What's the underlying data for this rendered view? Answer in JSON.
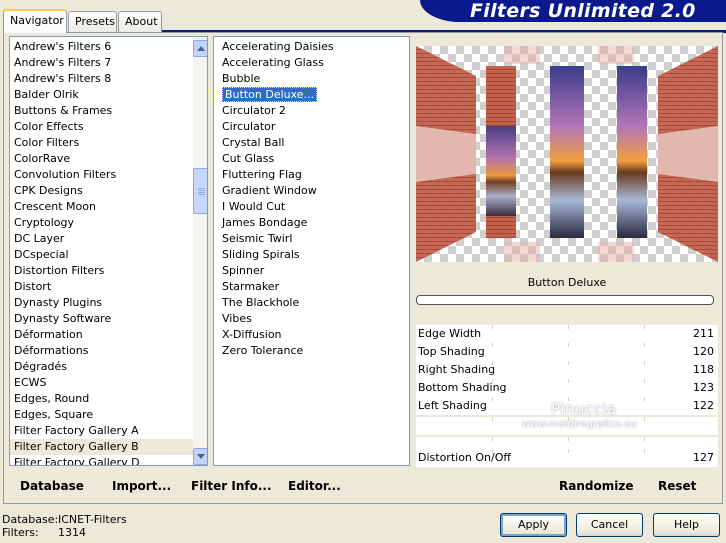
{
  "banner": {
    "title": "Filters Unlimited 2.0"
  },
  "tabs": [
    {
      "label": "Navigator",
      "active": true
    },
    {
      "label": "Presets",
      "active": false
    },
    {
      "label": "About",
      "active": false
    }
  ],
  "categories": {
    "items": [
      "Andrew's Filters 6",
      "Andrew's Filters 7",
      "Andrew's Filters 8",
      "Balder Olrik",
      "Buttons & Frames",
      "Color Effects",
      "Color Filters",
      "ColorRave",
      "Convolution Filters",
      "CPK Designs",
      "Crescent Moon",
      "Cryptology",
      "DC Layer",
      "DCspecial",
      "Distortion Filters",
      "Distort",
      "Dynasty Plugins",
      "Dynasty Software",
      "Déformation",
      "Déformations",
      "Dégradés",
      "ECWS",
      "Edges, Round",
      "Edges, Square",
      "Filter Factory Gallery A",
      "Filter Factory Gallery B",
      "Filter Factory Gallery D"
    ],
    "selected": "Filter Factory Gallery B"
  },
  "filters": {
    "items": [
      "Accelerating Daisies",
      "Accelerating Glass",
      "Bubble",
      "Button Deluxe...",
      "Circulator 2",
      "Circulator",
      "Crystal Ball",
      "Cut Glass",
      "Fluttering Flag",
      "Gradient Window",
      "I Would Cut",
      "James Bondage",
      "Seismic Twirl",
      "Sliding Spirals",
      "Spinner",
      "Starmaker",
      "The Blackhole",
      "Vibes",
      "X-Diffusion",
      "Zero Tolerance"
    ],
    "selected": "Button Deluxe..."
  },
  "left_links": [
    "Database",
    "Import...",
    "Filter Info...",
    "Editor..."
  ],
  "right_links": [
    "Randomize",
    "Reset"
  ],
  "filter_name": "Button Deluxe",
  "progress": 0,
  "params": [
    {
      "label": "Edge Width",
      "value": "211"
    },
    {
      "label": "Top Shading",
      "value": "120"
    },
    {
      "label": "Right Shading",
      "value": "118"
    },
    {
      "label": "Bottom Shading",
      "value": "123"
    },
    {
      "label": "Left Shading",
      "value": "122"
    },
    {
      "label": "",
      "value": ""
    },
    {
      "label": "",
      "value": ""
    },
    {
      "label": "Distortion On/Off",
      "value": "127"
    }
  ],
  "watermark": {
    "name": "Pinuccia",
    "url": "www.maidiregrafica.eu"
  },
  "status": {
    "database_label": "Database:",
    "database_value": "ICNET-Filters",
    "filters_label": "Filters:",
    "filters_value": "1314"
  },
  "buttons": {
    "apply": "Apply",
    "cancel": "Cancel",
    "help": "Help"
  },
  "colors": {
    "banner": "#0a1a8c",
    "selection": "#316ac5",
    "tab_accent": "#ffc83c"
  }
}
